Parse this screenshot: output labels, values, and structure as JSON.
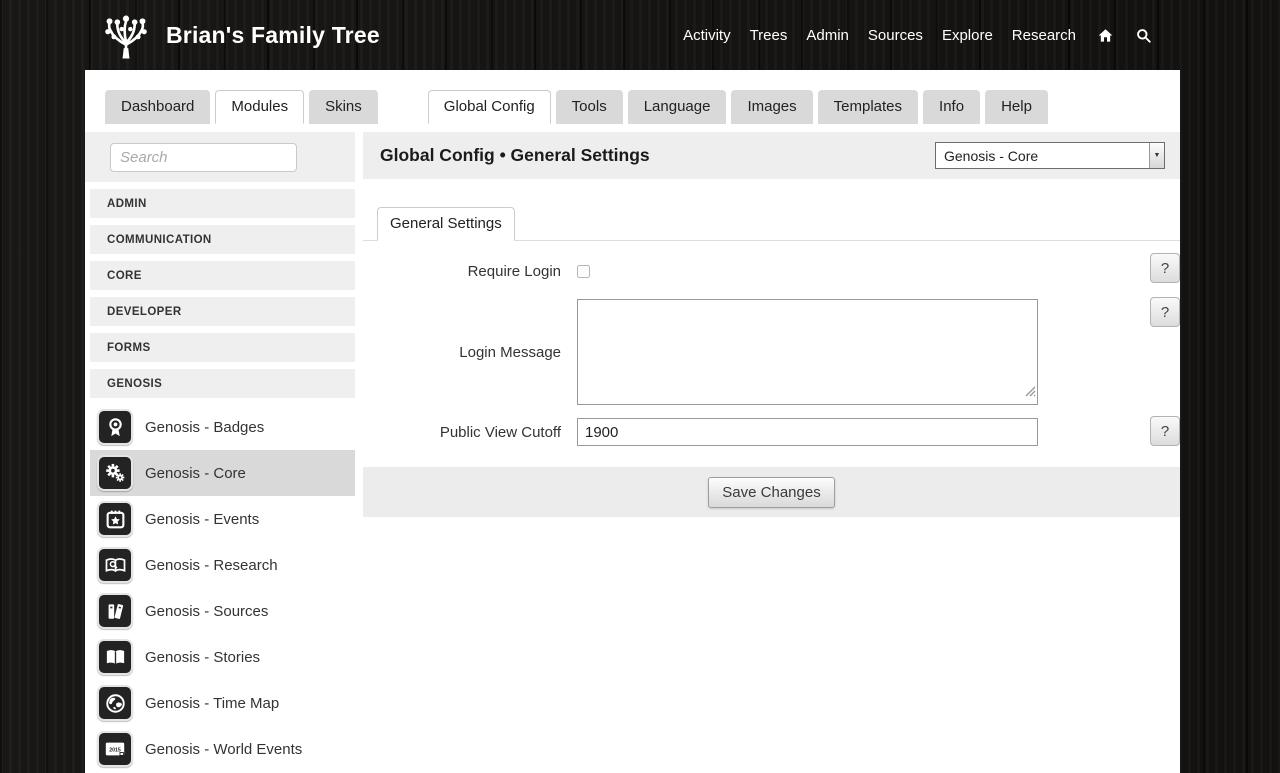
{
  "header": {
    "title": "Brian's Family Tree",
    "logo_icon": "family-tree-logo-icon",
    "nav": [
      "Activity",
      "Trees",
      "Admin",
      "Sources",
      "Explore",
      "Research"
    ],
    "nav_icons": [
      "home-icon",
      "search-icon"
    ]
  },
  "tabs": {
    "left": [
      {
        "label": "Dashboard",
        "active": false
      },
      {
        "label": "Modules",
        "active": true
      },
      {
        "label": "Skins",
        "active": false
      }
    ],
    "right": [
      {
        "label": "Global Config",
        "active": true
      },
      {
        "label": "Tools",
        "active": false
      },
      {
        "label": "Language",
        "active": false
      },
      {
        "label": "Images",
        "active": false
      },
      {
        "label": "Templates",
        "active": false
      },
      {
        "label": "Info",
        "active": false
      },
      {
        "label": "Help",
        "active": false
      }
    ]
  },
  "sidebar": {
    "search_placeholder": "Search",
    "search_value": "",
    "categories": [
      "ADMIN",
      "COMMUNICATION",
      "CORE",
      "DEVELOPER",
      "FORMS",
      "GENOSIS"
    ],
    "modules": [
      {
        "label": "Genosis - Badges",
        "icon": "badge-icon",
        "selected": false
      },
      {
        "label": "Genosis - Core",
        "icon": "gears-icon",
        "selected": true
      },
      {
        "label": "Genosis - Events",
        "icon": "calendar-star-icon",
        "selected": false
      },
      {
        "label": "Genosis - Research",
        "icon": "book-magnifier-icon",
        "selected": false
      },
      {
        "label": "Genosis - Sources",
        "icon": "two-books-icon",
        "selected": false
      },
      {
        "label": "Genosis - Stories",
        "icon": "open-book-icon",
        "selected": false
      },
      {
        "label": "Genosis - Time Map",
        "icon": "globe-icon",
        "selected": false
      },
      {
        "label": "Genosis - World Events",
        "icon": "year-frame-icon",
        "selected": false
      }
    ]
  },
  "main": {
    "title": "Global Config • General Settings",
    "module_select": {
      "value": "Genosis - Core",
      "arrow_icon": "dropdown-arrow-icon"
    },
    "subtab": "General Settings",
    "form": {
      "require_login": {
        "label": "Require Login",
        "checked": false
      },
      "login_message": {
        "label": "Login Message",
        "value": ""
      },
      "public_view_cutoff": {
        "label": "Public View Cutoff",
        "value": "1900"
      },
      "help_label": "?",
      "save_label": "Save Changes"
    }
  },
  "colors": {
    "header_wood_bg": "#191715",
    "content_bg": "#ffffff",
    "panel_bg": "#eeeeee",
    "inactive_tab_bg": "#d9d9d9",
    "selected_module_bg": "#d9d9d9",
    "module_icon_bg": "#232323",
    "text_dark": "#333333"
  }
}
